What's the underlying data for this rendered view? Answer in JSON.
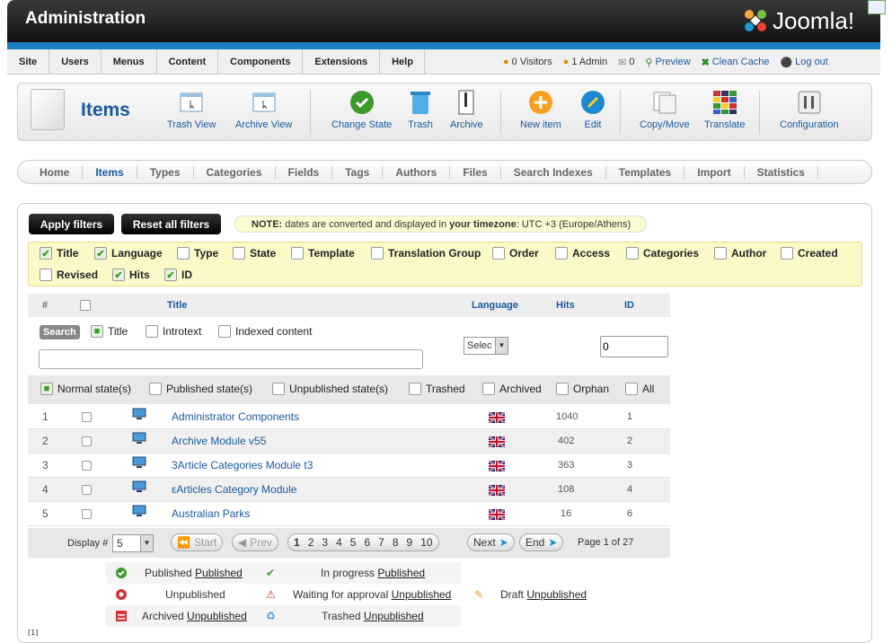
{
  "header": {
    "title": "Administration",
    "logo_text": "Joomla!"
  },
  "topmenu": [
    "Site",
    "Users",
    "Menus",
    "Content",
    "Components",
    "Extensions",
    "Help"
  ],
  "status": {
    "visitors": "0 Visitors",
    "admin": "1 Admin",
    "messages": "0",
    "preview": "Preview",
    "clean_cache": "Clean Cache",
    "logout": "Log out"
  },
  "toolbar": {
    "page_title": "Items",
    "buttons": [
      "Trash View",
      "Archive View",
      "Change State",
      "Trash",
      "Archive",
      "New item",
      "Edit",
      "Copy/Move",
      "Translate",
      "Configuration"
    ]
  },
  "subnav": [
    "Home",
    "Items",
    "Types",
    "Categories",
    "Fields",
    "Tags",
    "Authors",
    "Files",
    "Search Indexes",
    "Templates",
    "Import",
    "Statistics"
  ],
  "filters": {
    "apply": "Apply filters",
    "reset": "Reset all filters",
    "note_label": "NOTE:",
    "note_text": " dates are converted and displayed in ",
    "note_bold": "your timezone",
    "note_tz": ": UTC +3 (Europe/Athens)"
  },
  "columns": [
    {
      "label": "Title",
      "checked": true
    },
    {
      "label": "Language",
      "checked": true
    },
    {
      "label": "Type",
      "checked": false
    },
    {
      "label": "State",
      "checked": false
    },
    {
      "label": "Template",
      "checked": false
    },
    {
      "label": "Translation Group",
      "checked": false
    },
    {
      "label": "Order",
      "checked": false
    },
    {
      "label": "Access",
      "checked": false
    },
    {
      "label": "Categories",
      "checked": false
    },
    {
      "label": "Author",
      "checked": false
    },
    {
      "label": "Created",
      "checked": false
    },
    {
      "label": "Revised",
      "checked": false
    },
    {
      "label": "Hits",
      "checked": true
    },
    {
      "label": "ID",
      "checked": true
    }
  ],
  "table": {
    "headers": {
      "num": "#",
      "title": "Title",
      "language": "Language",
      "hits": "Hits",
      "id": "ID"
    },
    "search_label": "Search",
    "search_options": [
      "Title",
      "Introtext",
      "Indexed content"
    ],
    "lang_select": "Selec",
    "id_filter": "0",
    "states": [
      "Normal state(s)",
      "Published state(s)",
      "Unpublished state(s)",
      "Trashed",
      "Archived",
      "Orphan",
      "All"
    ],
    "rows": [
      {
        "num": "1",
        "title": "Administrator Components",
        "hits": "1040",
        "id": "1"
      },
      {
        "num": "2",
        "title": "Archive Module v55",
        "hits": "402",
        "id": "2"
      },
      {
        "num": "3",
        "title": "3Article Categories Module t3",
        "hits": "363",
        "id": "3"
      },
      {
        "num": "4",
        "title": "εArticles Category Module",
        "hits": "108",
        "id": "4"
      },
      {
        "num": "5",
        "title": "Australian Parks",
        "hits": "16",
        "id": "6"
      }
    ]
  },
  "pager": {
    "display_label": "Display #",
    "display_value": "5",
    "start": "Start",
    "prev": "Prev",
    "pages": [
      "1",
      "2",
      "3",
      "4",
      "5",
      "6",
      "7",
      "8",
      "9",
      "10"
    ],
    "next": "Next",
    "end": "End",
    "page_info": "Page 1 of 27"
  },
  "legend": {
    "published": "Published",
    "published_u": "Published",
    "in_progress": "In progress",
    "in_progress_u": "Published",
    "unpublished": "Unpublished",
    "waiting": "Waiting for approval",
    "waiting_u": "Unpublished",
    "draft": "Draft",
    "draft_u": "Unpublished",
    "archived": "Archived",
    "archived_u": "Unpublished",
    "trashed": "Trashed",
    "trashed_u": "Unpublished"
  },
  "footnote": "[1]"
}
